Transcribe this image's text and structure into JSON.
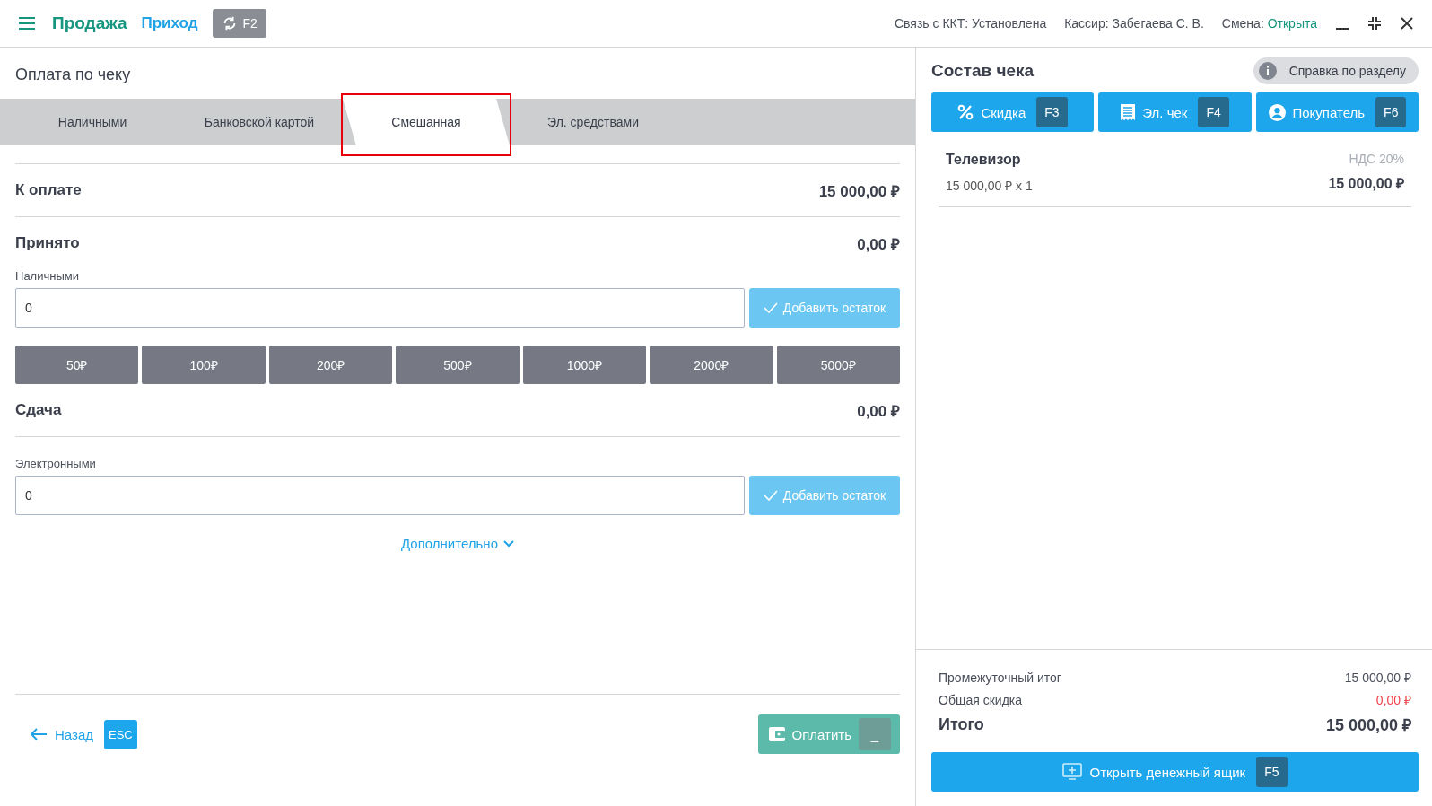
{
  "topbar": {
    "title": "Продажа",
    "mode": "Приход",
    "switch_key": "F2",
    "status": [
      {
        "label": "Связь с ККТ:",
        "value": "Установлена",
        "accent": false
      },
      {
        "label": "Кассир:",
        "value": "Забегаева С. В.",
        "accent": false
      },
      {
        "label": "Смена:",
        "value": "Открыта",
        "accent": true
      }
    ]
  },
  "payment": {
    "title": "Оплата по чеку",
    "tabs": [
      {
        "label": "Наличными",
        "selected": false
      },
      {
        "label": "Банковской картой",
        "selected": false
      },
      {
        "label": "Смешанная",
        "selected": true
      },
      {
        "label": "Эл. средствами",
        "selected": false
      }
    ],
    "due": {
      "label": "К оплате",
      "amount": "15 000,00 ₽"
    },
    "received": {
      "label": "Принято",
      "amount": "0,00 ₽"
    },
    "cash": {
      "label": "Наличными",
      "value": "0",
      "add_button": "Добавить остаток"
    },
    "quick_amounts": [
      "50₽",
      "100₽",
      "200₽",
      "500₽",
      "1000₽",
      "2000₽",
      "5000₽"
    ],
    "change": {
      "label": "Сдача",
      "amount": "0,00 ₽"
    },
    "electronic": {
      "label": "Электронными",
      "value": "0",
      "add_button": "Добавить остаток"
    },
    "more": "Дополнительно",
    "back": {
      "label": "Назад",
      "key": "ESC"
    },
    "pay": {
      "label": "Оплатить",
      "key": "_"
    }
  },
  "receipt": {
    "title": "Состав чека",
    "help": "Справка по разделу",
    "actions": [
      {
        "kind": "discount",
        "label": "Скидка",
        "key": "F3"
      },
      {
        "kind": "ereceipt",
        "label": "Эл. чек",
        "key": "F4"
      },
      {
        "kind": "customer",
        "label": "Покупатель",
        "key": "F6"
      }
    ],
    "items": [
      {
        "name": "Телевизор",
        "price": "15 000,00 ₽ x 1",
        "vat": "НДС 20%",
        "total": "15 000,00 ₽"
      }
    ],
    "totals": [
      {
        "kind": "subtotal",
        "label": "Промежуточный итог",
        "amount": "15 000,00 ₽"
      },
      {
        "kind": "discount",
        "label": "Общая скидка",
        "amount": "0,00 ₽"
      },
      {
        "kind": "grand",
        "label": "Итого",
        "amount": "15 000,00 ₽"
      }
    ],
    "drawer": {
      "label": "Открыть денежный ящик",
      "key": "F5"
    }
  }
}
